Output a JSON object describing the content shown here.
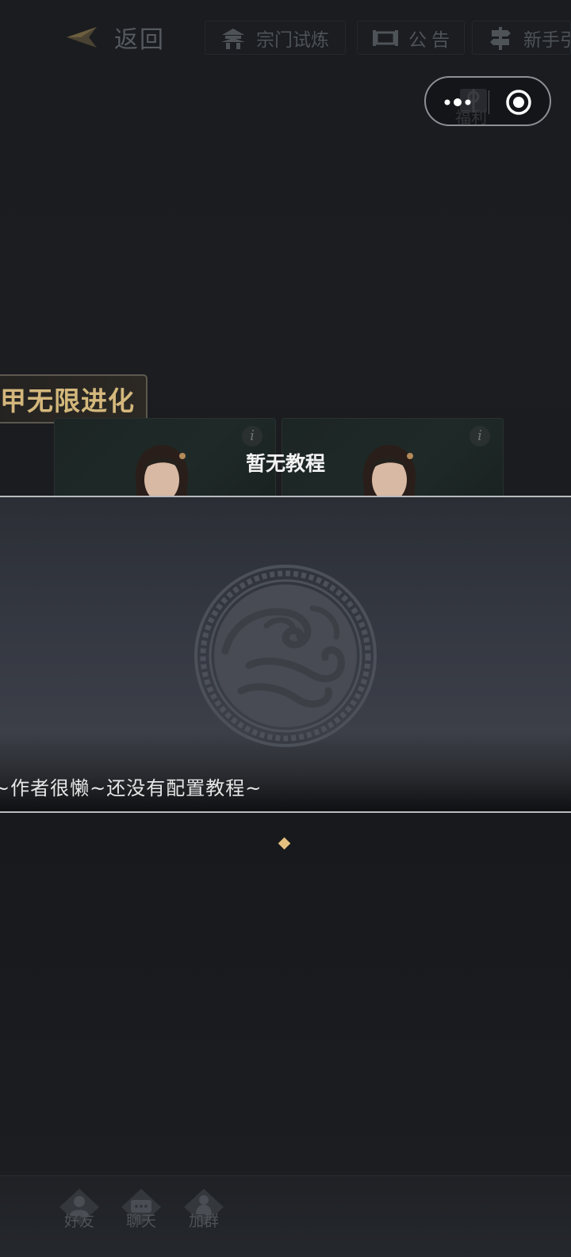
{
  "nav": {
    "back_label": "返回",
    "buttons": [
      {
        "label": "宗门试炼",
        "icon": "pagoda-icon"
      },
      {
        "label": "公告",
        "icon": "scroll-icon"
      },
      {
        "label": "新手引",
        "icon": "signpost-icon"
      }
    ]
  },
  "welfare": {
    "label": "福利"
  },
  "banner": {
    "text": "甲无限进化"
  },
  "cards": [
    {
      "info": "i"
    },
    {
      "info": "i"
    }
  ],
  "cards_title": "暂无教程",
  "modal": {
    "message": "~作者很懒~还没有配置教程~"
  },
  "bottom_bar": {
    "items": [
      {
        "label": "好友",
        "icon": "friend-icon"
      },
      {
        "label": "聊天",
        "icon": "chat-icon"
      },
      {
        "label": "加群",
        "icon": "group-icon"
      }
    ]
  },
  "colors": {
    "accent_gold": "#d4b87c",
    "diamond": "#e5c07f",
    "background": "#151619"
  }
}
